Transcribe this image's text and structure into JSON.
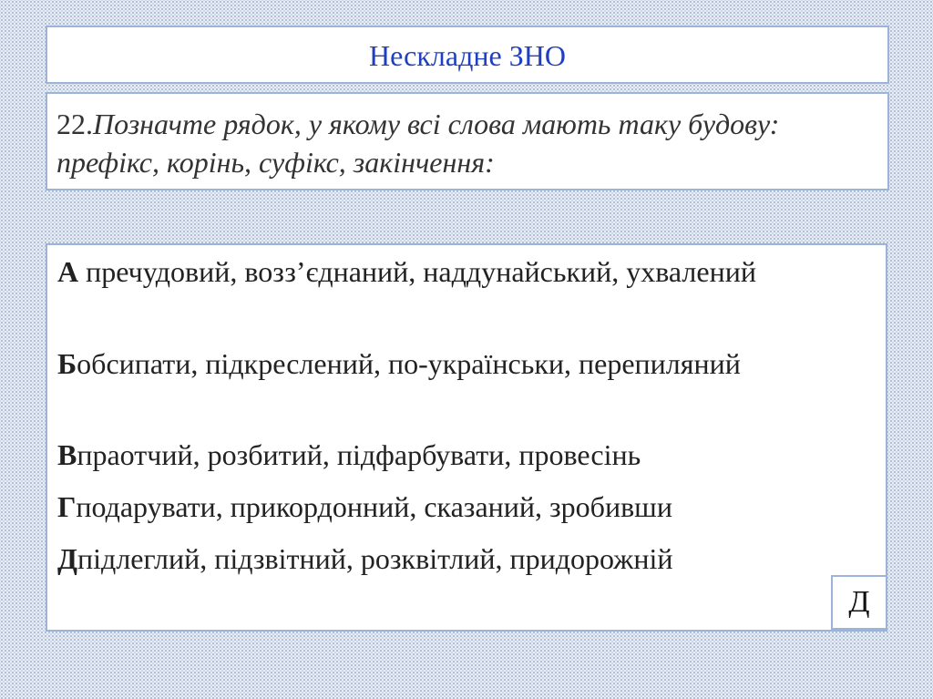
{
  "header": {
    "title": "Нескладне ЗНО"
  },
  "question": {
    "number": "22.",
    "text": "Позначте рядок, у якому всі слова мають таку будову: префікс, корінь, суфікс, закінчення:"
  },
  "options": [
    {
      "letter": "А",
      "separator": " ",
      "text": "пречудовий, возз’єднаний, наддунайський, ухвалений"
    },
    {
      "letter": "Б",
      "separator": "",
      "text": "обсипати, підкреслений, по-українськи, перепиляний"
    },
    {
      "letter": "В",
      "separator": "",
      "text": "праотчий, розбитий, підфарбувати, провесінь"
    },
    {
      "letter": "Г",
      "separator": "",
      "text": "подарувати, прикордонний, сказаний, зробивши"
    },
    {
      "letter": "Д",
      "separator": "",
      "text": "підлеглий, підзвітний, розквітлий, придорожній"
    }
  ],
  "answer": "Д"
}
